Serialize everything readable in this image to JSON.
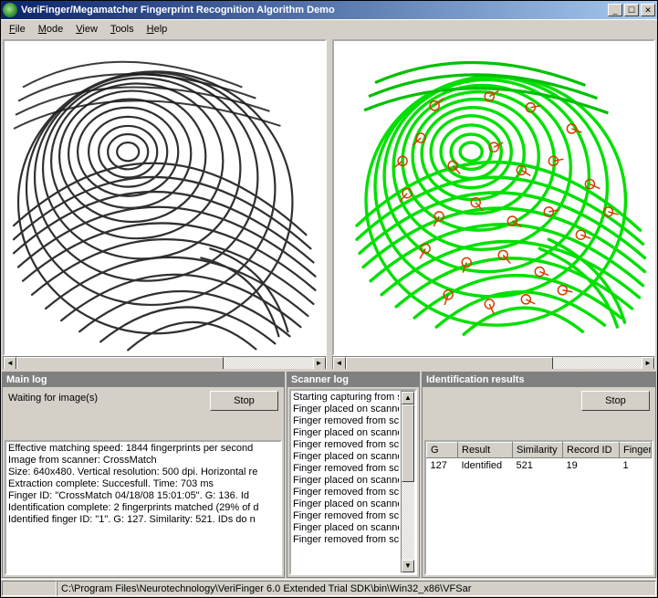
{
  "window": {
    "title": "VeriFinger/Megamatcher Fingerprint Recognition Algorithm Demo"
  },
  "menu": {
    "items": [
      {
        "pre": "",
        "ul": "F",
        "post": "ile"
      },
      {
        "pre": "",
        "ul": "M",
        "post": "ode"
      },
      {
        "pre": "",
        "ul": "V",
        "post": "iew"
      },
      {
        "pre": "",
        "ul": "T",
        "post": "ools"
      },
      {
        "pre": "",
        "ul": "H",
        "post": "elp"
      }
    ]
  },
  "panels": {
    "main_log": {
      "title": "Main log",
      "wait_text": "Waiting for image(s)",
      "stop_label": "Stop",
      "lines": [
        "Effective matching speed: 1844 fingerprints per second",
        "",
        "Image from scanner: CrossMatch",
        "Size: 640x480. Vertical resolution: 500 dpi. Horizontal re",
        "Extraction complete: Succesfull. Time: 703 ms",
        "Finger ID: \"CrossMatch 04/18/08 15:01:05\". G: 136. Id",
        "Identification complete: 2 fingerprints matched (29% of d",
        "Identified finger ID: \"1\". G: 127. Similarity: 521. IDs do n"
      ]
    },
    "scanner_log": {
      "title": "Scanner log",
      "lines": [
        "Starting capturing from sc",
        "Finger placed on scanne",
        "Finger removed from scan",
        "Finger placed on scanne",
        "Finger removed from scan",
        "Finger placed on scanne",
        "Finger removed from scan",
        "Finger placed on scanne",
        "Finger removed from scan",
        "Finger placed on scanne",
        "Finger removed from scan",
        "Finger placed on scanne",
        "Finger removed from scan"
      ]
    },
    "results": {
      "title": "Identification results",
      "stop_label": "Stop",
      "columns": [
        "G",
        "Result",
        "Similarity",
        "Record ID",
        "Finger ID"
      ],
      "row": {
        "g": "127",
        "result": "Identified",
        "similarity": "521",
        "record_id": "19",
        "finger_id": "1"
      }
    }
  },
  "statusbar": {
    "cell0": "",
    "cell1": "C:\\Program Files\\Neurotechnology\\VeriFinger 6.0 Extended Trial SDK\\bin\\Win32_x86\\VFSar"
  }
}
